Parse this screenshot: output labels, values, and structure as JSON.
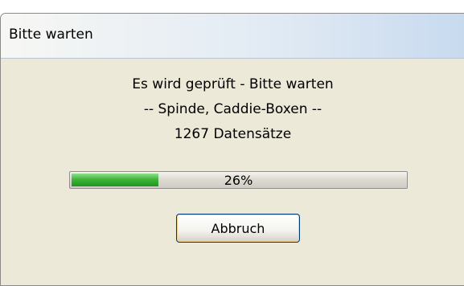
{
  "window": {
    "title": "Bitte warten"
  },
  "message": {
    "line1": "Es wird geprüft - Bitte warten",
    "line2": "-- Spinde, Caddie-Boxen --",
    "line3": "1267 Datensätze"
  },
  "progress": {
    "value": 0.26,
    "label": "26%"
  },
  "buttons": {
    "cancel_label": "Abbruch"
  },
  "colors": {
    "progress_fill": "#3fb53b",
    "dialog_background": "#ece9d8",
    "button_border": "#003c74"
  }
}
